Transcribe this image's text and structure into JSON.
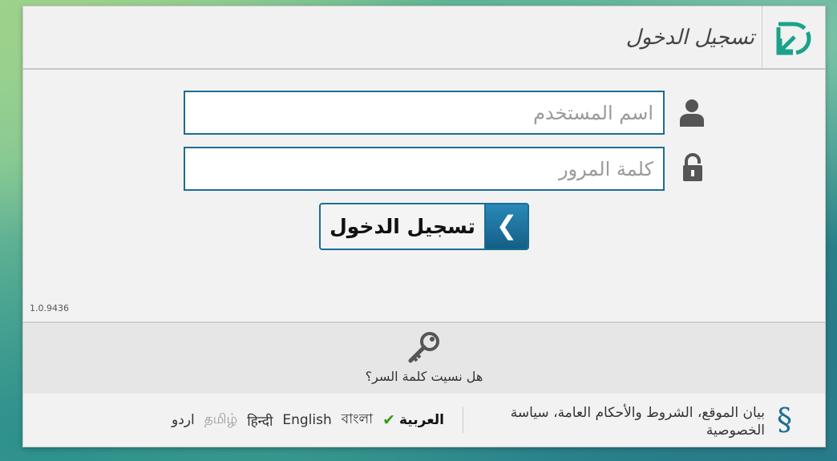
{
  "header": {
    "title": "تسجيل الدخول",
    "logo_icon": "brand-logo-icon",
    "logo_color": "#1aa38a"
  },
  "form": {
    "username_placeholder": "اسم المستخدم",
    "username_value": "",
    "password_placeholder": "كلمة المرور",
    "password_value": "",
    "username_icon": "user-icon",
    "password_icon": "lock-icon",
    "login_button_label": "تسجيل الدخول",
    "login_button_icon": "chevron-left-icon",
    "accent_color": "#1b6d93"
  },
  "version": "1.0.9436",
  "forgot": {
    "icon": "key-icon",
    "label": "هل نسيت كلمة السر؟"
  },
  "footer": {
    "legal_icon": "section-icon",
    "legal_text": "بيان الموقع، الشروط والأحكام العامة، سياسة الخصوصية",
    "languages": [
      {
        "label": "العربية",
        "active": true
      },
      {
        "label": "বাংলা",
        "active": false
      },
      {
        "label": "English",
        "active": false
      },
      {
        "label": "हिन्दी",
        "active": false
      },
      {
        "label": "தமிழ்",
        "active": false
      },
      {
        "label": "اردو",
        "active": false
      }
    ]
  }
}
